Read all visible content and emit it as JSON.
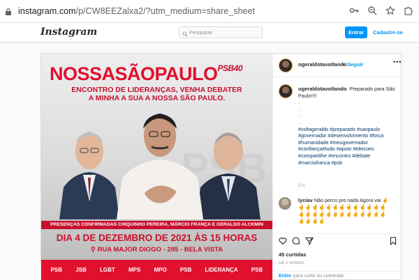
{
  "browser": {
    "url_host": "instagram.com",
    "url_path": "/p/CW8EEZalxa2/?utm_medium=share_sheet",
    "icons": [
      "lock-icon",
      "key-icon",
      "zoom-icon",
      "star-icon",
      "puzzle-icon"
    ]
  },
  "topbar": {
    "logo": "Instagram",
    "search_placeholder": "Pesquisar",
    "login_label": "Entrar",
    "signup_label": "Cadastre-se"
  },
  "image": {
    "title_part1": "NOSSA",
    "title_part2": "SÃOPAULO",
    "title_party": "PSB40",
    "subtitle_line1": "ENCONTRO DE LIDERANÇAS, VENHA DEBATER",
    "subtitle_line2": "A MINHA A SUA A NOSSA SÃO PAULO.",
    "background_word": "PSB",
    "banner": "PRESENÇAS CONFIRMADAS CHIQUINHO PEREIRA, MÁRCIO FRANÇA E GERALDO ALCKMIN",
    "date": "DIA 4 DE DEZEMBRO DE 2021 ÀS 15 HORAS",
    "address": "RUA MAJOR DIOGO - 285 - BELA VISTA",
    "logos": [
      "PSB",
      "JSB",
      "LGBT",
      "MPS",
      "MPO",
      "PSB",
      "LIDERANÇA",
      "PSB"
    ]
  },
  "post": {
    "username": "ogeraldotavoltando",
    "separator": "•",
    "follow_label": "Seguir",
    "more_label": "•••",
    "caption_text": "Preparado para São Paulo!!!!",
    "caption_dots": [
      ".",
      ".",
      ".",
      "."
    ],
    "hashtags": "#voltageraldo #preparado #saopaulo #governador #desenvolvimento #força #humanidade #meugovernador #confiançaétudo #apoio #eleicoes #compartilhe #encontro #debate #marciofranca #psb",
    "caption_age": "2 n",
    "comment_user": "lyciav",
    "comment_text": "Não perco pro nada Agora vai 🤞",
    "comment_emojis_line1": "🤞🤞🤞🤞🤞🤞🤞🤞🤞🤞🤞🤞🤞",
    "comment_emojis_line2": "🤞🤞🤞🤞🤞🤞🤞🤞🤞🤞🤞🤞🤞",
    "comment_emojis_line3": "🤞🤞🤞🤞",
    "likes": "45 curtidas",
    "time": "HÁ 2 HORAS",
    "add_comment_link": "Entre",
    "add_comment_rest": "para curtir ou comentar."
  }
}
